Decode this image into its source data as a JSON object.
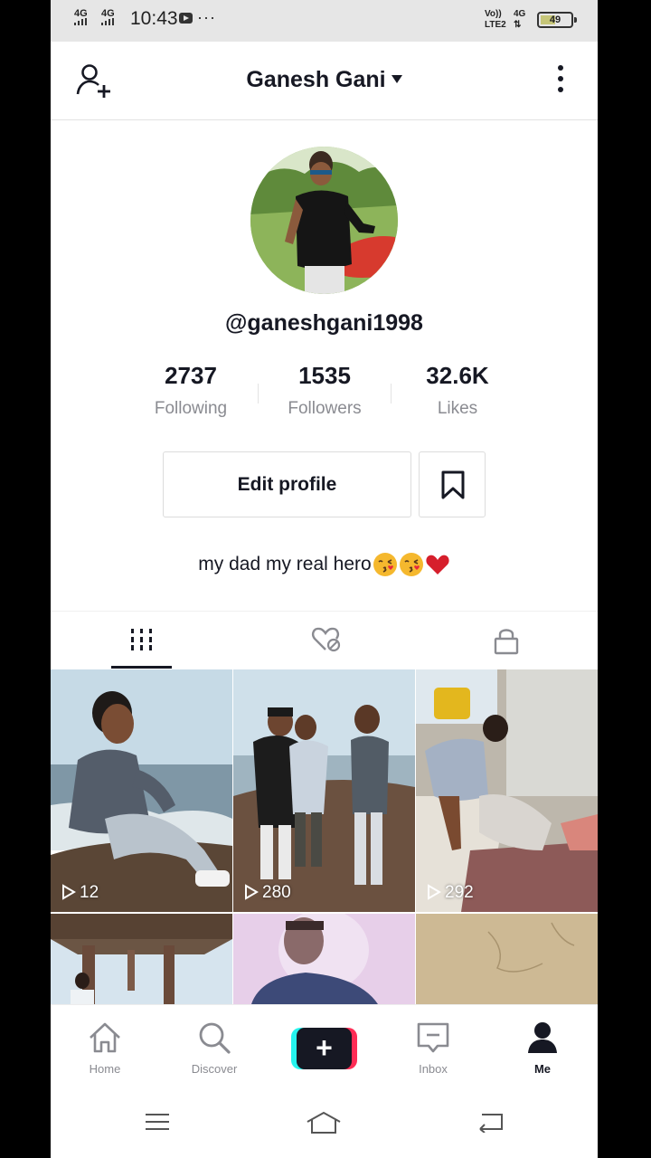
{
  "status_bar": {
    "signal1": "4G",
    "signal2": "4G",
    "time": "10:43",
    "indicators": "···",
    "volte_line1": "Vo))",
    "volte_line2": "LTE2",
    "network_line1": "4G",
    "network_line2": "⇅",
    "battery_label": "49",
    "battery_level_percent": 49
  },
  "header": {
    "title": "Ganesh Gani",
    "add_friend_icon": "add-person-icon",
    "more_icon": "vertical-dots-icon"
  },
  "profile": {
    "username": "@ganeshgani1998",
    "stats": [
      {
        "value": "2737",
        "label": "Following"
      },
      {
        "value": "1535",
        "label": "Followers"
      },
      {
        "value": "32.6K",
        "label": "Likes"
      }
    ],
    "edit_button": "Edit profile",
    "bookmark_icon": "bookmark-icon",
    "bio": "my dad my real hero",
    "bio_emojis": [
      "kissing-face-emoji",
      "kissing-face-emoji",
      "red-heart-emoji"
    ]
  },
  "tabs": [
    {
      "name": "videos",
      "icon": "grid-icon",
      "active": true
    },
    {
      "name": "liked",
      "icon": "hidden-heart-icon",
      "active": false
    },
    {
      "name": "private",
      "icon": "lock-icon",
      "active": false
    }
  ],
  "videos": [
    {
      "views": "12"
    },
    {
      "views": "280"
    },
    {
      "views": "292"
    },
    {
      "views": ""
    },
    {
      "views": ""
    },
    {
      "views": ""
    }
  ],
  "bottom_nav": {
    "home": "Home",
    "discover": "Discover",
    "create_label": "+",
    "inbox": "Inbox",
    "me": "Me"
  },
  "colors": {
    "text": "#161823",
    "secondary": "#8a8b91",
    "create_cyan": "#25f4ee",
    "create_pink": "#fe2c55"
  }
}
